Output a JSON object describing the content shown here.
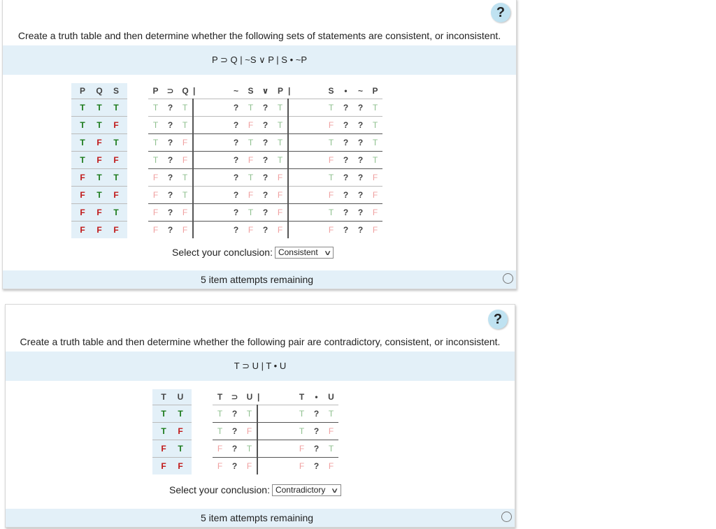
{
  "questions": [
    {
      "help_label": "?",
      "prompt": "Create a truth table and then determine whether the following sets of statements are consistent, or inconsistent.",
      "formula": "P ⊃ Q | ~S ∨ P | S • ~P",
      "table": {
        "base_headers": [
          "P",
          "Q",
          "S"
        ],
        "groups": [
          {
            "headers": [
              "P",
              "⊃",
              "Q"
            ]
          },
          {
            "headers": [
              "~",
              "S",
              "∨",
              "P"
            ]
          },
          {
            "headers": [
              "S",
              "•",
              "~",
              "P"
            ]
          }
        ],
        "separator": "|",
        "rows": [
          {
            "base": [
              "T",
              "T",
              "T"
            ],
            "g": [
              [
                "T",
                "?",
                "T"
              ],
              [
                "?",
                "T",
                "?",
                "T"
              ],
              [
                "T",
                "?",
                "?",
                "T"
              ]
            ]
          },
          {
            "base": [
              "T",
              "T",
              "F"
            ],
            "g": [
              [
                "T",
                "?",
                "T"
              ],
              [
                "?",
                "F",
                "?",
                "T"
              ],
              [
                "F",
                "?",
                "?",
                "T"
              ]
            ]
          },
          {
            "base": [
              "T",
              "F",
              "T"
            ],
            "g": [
              [
                "T",
                "?",
                "F"
              ],
              [
                "?",
                "T",
                "?",
                "T"
              ],
              [
                "T",
                "?",
                "?",
                "T"
              ]
            ]
          },
          {
            "base": [
              "T",
              "F",
              "F"
            ],
            "g": [
              [
                "T",
                "?",
                "F"
              ],
              [
                "?",
                "F",
                "?",
                "T"
              ],
              [
                "F",
                "?",
                "?",
                "T"
              ]
            ]
          },
          {
            "base": [
              "F",
              "T",
              "T"
            ],
            "g": [
              [
                "F",
                "?",
                "T"
              ],
              [
                "?",
                "T",
                "?",
                "F"
              ],
              [
                "T",
                "?",
                "?",
                "F"
              ]
            ]
          },
          {
            "base": [
              "F",
              "T",
              "F"
            ],
            "g": [
              [
                "F",
                "?",
                "T"
              ],
              [
                "?",
                "F",
                "?",
                "F"
              ],
              [
                "F",
                "?",
                "?",
                "F"
              ]
            ]
          },
          {
            "base": [
              "F",
              "F",
              "T"
            ],
            "g": [
              [
                "F",
                "?",
                "F"
              ],
              [
                "?",
                "T",
                "?",
                "F"
              ],
              [
                "T",
                "?",
                "?",
                "F"
              ]
            ]
          },
          {
            "base": [
              "F",
              "F",
              "F"
            ],
            "g": [
              [
                "F",
                "?",
                "F"
              ],
              [
                "?",
                "F",
                "?",
                "F"
              ],
              [
                "F",
                "?",
                "?",
                "F"
              ]
            ]
          }
        ]
      },
      "conclusion_label": "Select your conclusion:",
      "conclusion_value": "Consistent",
      "attempts": "5 item attempts remaining"
    },
    {
      "help_label": "?",
      "prompt": "Create a truth table and then determine whether the following pair are contradictory, consistent, or inconsistent.",
      "formula": "T ⊃ U | T • U",
      "table": {
        "base_headers": [
          "T",
          "U"
        ],
        "groups": [
          {
            "headers": [
              "T",
              "⊃",
              "U"
            ]
          },
          {
            "headers": [
              "T",
              "•",
              "U"
            ]
          }
        ],
        "separator": "|",
        "rows": [
          {
            "base": [
              "T",
              "T"
            ],
            "g": [
              [
                "T",
                "?",
                "T"
              ],
              [
                "T",
                "?",
                "T"
              ]
            ]
          },
          {
            "base": [
              "T",
              "F"
            ],
            "g": [
              [
                "T",
                "?",
                "F"
              ],
              [
                "T",
                "?",
                "F"
              ]
            ]
          },
          {
            "base": [
              "F",
              "T"
            ],
            "g": [
              [
                "F",
                "?",
                "T"
              ],
              [
                "F",
                "?",
                "T"
              ]
            ]
          },
          {
            "base": [
              "F",
              "F"
            ],
            "g": [
              [
                "F",
                "?",
                "F"
              ],
              [
                "F",
                "?",
                "F"
              ]
            ]
          }
        ]
      },
      "conclusion_label": "Select your conclusion:",
      "conclusion_value": "Contradictory",
      "attempts": "5 item attempts remaining"
    }
  ],
  "icons": {
    "chevron": "chevron-down-icon",
    "status": "empty-circle-icon"
  }
}
